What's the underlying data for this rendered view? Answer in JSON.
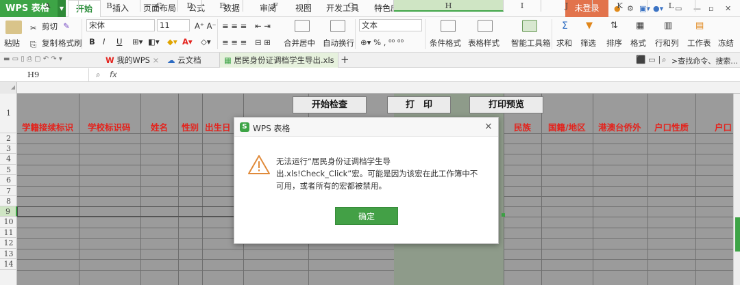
{
  "app": {
    "name": "WPS 表格",
    "dropdown_icon": "caret-down-icon"
  },
  "menu": {
    "items": [
      "开始",
      "插入",
      "页面布局",
      "公式",
      "数据",
      "审阅",
      "视图",
      "开发工具",
      "特色应用"
    ],
    "active": "开始",
    "login": "未登录"
  },
  "ribbon": {
    "paste": "粘贴",
    "cut": "剪切",
    "copy": "复制",
    "format_painter": "格式刷",
    "font_name": "宋体",
    "font_size": "11",
    "merge_center": "合并居中",
    "wrap_text": "自动换行",
    "number_format": "文本",
    "conditional_format": "条件格式",
    "table_style": "表格样式",
    "smart_toolbox": "智能工具箱",
    "sum": "求和",
    "filter": "筛选",
    "sort": "排序",
    "format": "格式",
    "rows_cols": "行和列",
    "worksheet": "工作表",
    "freeze": "冻结"
  },
  "tabs": {
    "my_wps": "我的WPS",
    "cloud_docs": "云文档",
    "current_file": "居民身份证调档学生导出.xls",
    "search_placeholder": ">查找命令、搜索..."
  },
  "formula_bar": {
    "cell_ref": "H9",
    "fx": "fx",
    "value": ""
  },
  "grid": {
    "columns": [
      "A",
      "B",
      "C",
      "D",
      "E",
      "F",
      "G",
      "H",
      "I",
      "J",
      "K",
      "L"
    ],
    "selected_column": "H",
    "selected_row": "9",
    "rows": [
      "1",
      "2",
      "3",
      "4",
      "5",
      "6",
      "7",
      "8",
      "9",
      "10",
      "11",
      "12",
      "13",
      "14"
    ],
    "headers": [
      "学籍接续标识",
      "学校标识码",
      "姓名",
      "性别",
      "出生日",
      "民族",
      "国籍/地区",
      "港澳台侨外",
      "户口性质",
      "户口"
    ],
    "buttons": {
      "start_check": "开始检查",
      "print": "打　印",
      "print_preview": "打印预览"
    }
  },
  "dialog": {
    "title": "WPS 表格",
    "message_line1": "无法运行“居民身份证调档学生导",
    "message_line2": "出.xls!Check_Click”宏。可能是因为该宏在此工作簿中不",
    "message_line3": "可用，或者所有的宏都被禁用。",
    "ok": "确定",
    "close": "×"
  },
  "colors": {
    "accent": "#3da446",
    "header_text": "#e3231d",
    "login": "#e2734c"
  }
}
